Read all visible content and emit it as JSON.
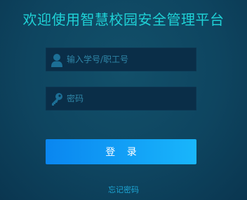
{
  "title": "欢迎使用智慧校园安全管理平台",
  "username": {
    "placeholder": "输入学号/职工号",
    "value": "",
    "icon": "user-icon"
  },
  "password": {
    "placeholder": "密码",
    "value": "",
    "icon": "key-icon"
  },
  "login_button": {
    "label": "登 录"
  },
  "forgot_link": {
    "label": "忘记密码"
  },
  "colors": {
    "title": "#1fd1d6",
    "button_start": "#0a86f0",
    "button_end": "#19b6fb",
    "icon": "#1c6f96"
  }
}
